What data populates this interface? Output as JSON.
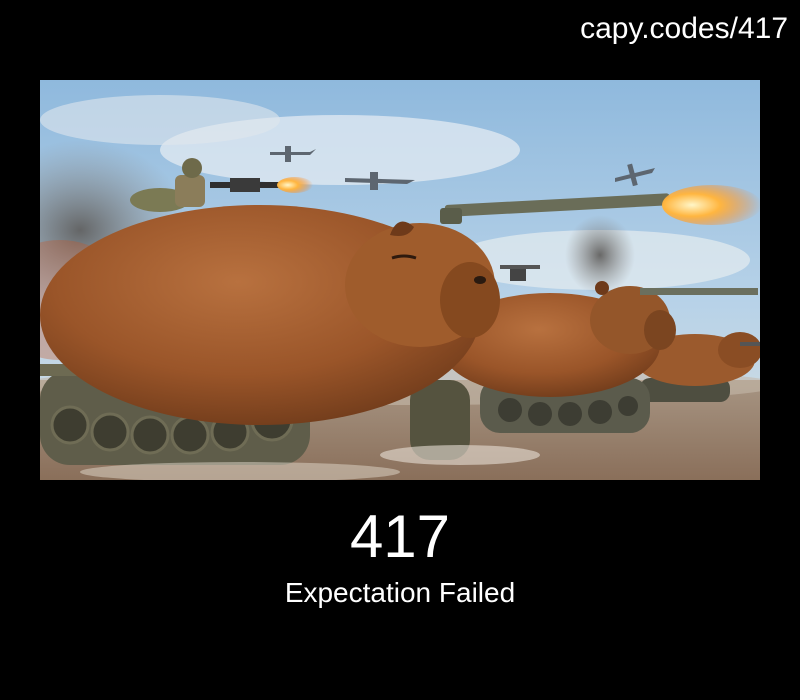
{
  "header": {
    "site_link": "capy.codes/417"
  },
  "image": {
    "alt": "Capybaras as tanks",
    "icon": "capybara-tanks-illustration"
  },
  "status": {
    "code": "417",
    "message": "Expectation Failed"
  },
  "colors": {
    "background": "#000000",
    "text": "#ffffff"
  }
}
